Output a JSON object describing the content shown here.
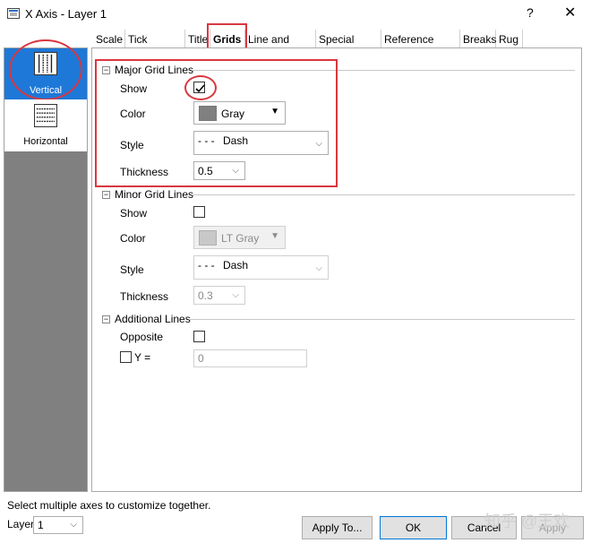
{
  "window": {
    "title": "X Axis - Layer 1",
    "help_glyph": "?",
    "close_glyph": "✕"
  },
  "tabs": [
    {
      "label": "Scale"
    },
    {
      "label": "Tick Labels"
    },
    {
      "label": "Title"
    },
    {
      "label": "Grids",
      "active": true
    },
    {
      "label": "Line and Ticks"
    },
    {
      "label": "Special Ticks"
    },
    {
      "label": "Reference Lines"
    },
    {
      "label": "Breaks"
    },
    {
      "label": "Rug"
    }
  ],
  "sidebar": {
    "items": [
      {
        "label": "Vertical",
        "selected": true
      },
      {
        "label": "Horizontal",
        "selected": false
      }
    ]
  },
  "major": {
    "header": "Major Grid Lines",
    "show_label": "Show",
    "show_checked": true,
    "color_label": "Color",
    "color_value": "Gray",
    "color_hex": "#808080",
    "style_label": "Style",
    "style_value": "Dash",
    "style_glyph": "- - -",
    "thickness_label": "Thickness",
    "thickness_value": "0.5"
  },
  "minor": {
    "header": "Minor Grid Lines",
    "show_label": "Show",
    "show_checked": false,
    "color_label": "Color",
    "color_value": "LT Gray",
    "color_hex": "#c8c8c8",
    "style_label": "Style",
    "style_value": "Dash",
    "style_glyph": "- - -",
    "thickness_label": "Thickness",
    "thickness_value": "0.3"
  },
  "additional": {
    "header": "Additional Lines",
    "opposite_label": "Opposite",
    "opposite_checked": false,
    "y_label": "Y =",
    "y_checked": false,
    "y_value": "0"
  },
  "footer": {
    "status": "Select multiple axes to customize together.",
    "layer_label": "Layer",
    "layer_value": "1",
    "apply_to_label": "Apply To...",
    "ok_label": "OK",
    "cancel_label": "Cancel",
    "apply_label": "Apply"
  },
  "watermark": "知乎 @王欢",
  "colors": {
    "selected_item": "#1e78d7",
    "annotation_red": "#d9373f",
    "sidebar_bg": "#808080"
  }
}
